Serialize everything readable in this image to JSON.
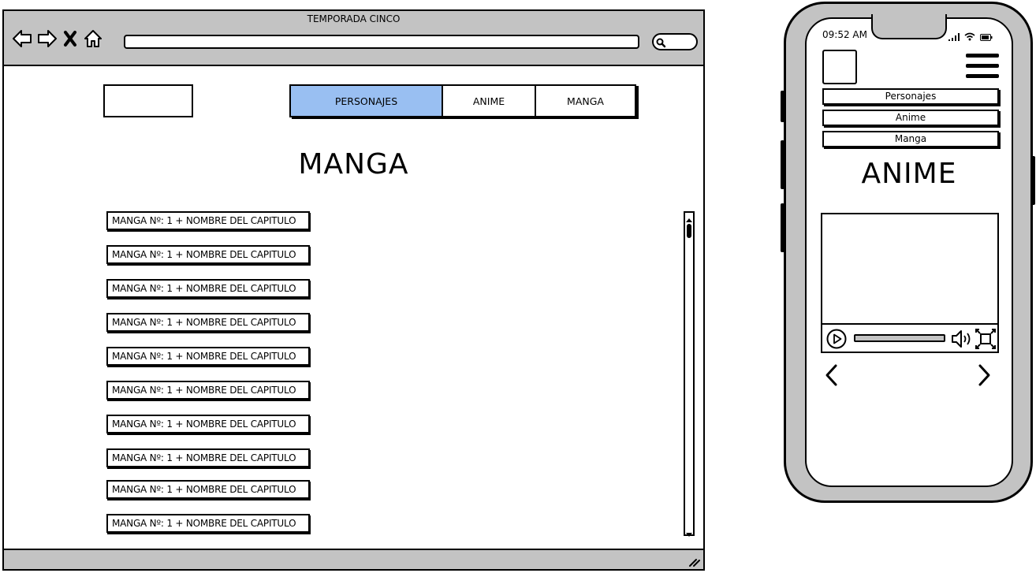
{
  "browser": {
    "title": "TEMPORADA CINCO",
    "address": "",
    "tabs": [
      {
        "label": "PERSONAJES",
        "active": true
      },
      {
        "label": "ANIME",
        "active": false
      },
      {
        "label": "MANGA",
        "active": false
      }
    ],
    "page_title": "MANGA",
    "chapters": [
      "MANGA Nº: 1 + NOMBRE DEL CAPITULO",
      "MANGA Nº: 1 + NOMBRE DEL CAPITULO",
      "MANGA Nº: 1 + NOMBRE DEL CAPITULO",
      "MANGA Nº: 1 + NOMBRE DEL CAPITULO",
      "MANGA Nº: 1 + NOMBRE DEL CAPITULO",
      "MANGA Nº: 1 + NOMBRE DEL CAPITULO",
      "MANGA Nº: 1 + NOMBRE DEL CAPITULO",
      "MANGA Nº: 1 + NOMBRE DEL CAPITULO",
      "MANGA Nº: 1 + NOMBRE DEL CAPITULO",
      "MANGA Nº: 1 + NOMBRE DEL CAPITULO"
    ],
    "nav_icons": [
      "back-icon",
      "forward-icon",
      "close-icon",
      "home-icon"
    ],
    "active_tab_color": "#99bff2",
    "chrome_color": "#c3c3c3"
  },
  "phone": {
    "time": "09:52 AM",
    "status_icons": [
      "signal-icon",
      "wifi-icon",
      "battery-icon"
    ],
    "menu": [
      {
        "label": "Personajes"
      },
      {
        "label": "Anime"
      },
      {
        "label": "Manga"
      }
    ],
    "page_title": "ANIME",
    "video": {
      "progress": 0.98
    },
    "pager": [
      "chevron-left-icon",
      "chevron-right-icon"
    ]
  }
}
